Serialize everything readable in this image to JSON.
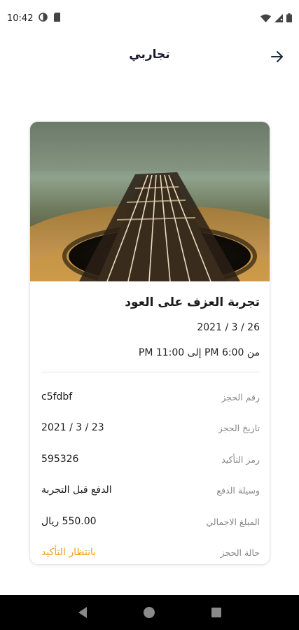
{
  "status_bar": {
    "time": "10:42"
  },
  "header": {
    "title": "تجاربي",
    "back_icon": "arrow-right-icon"
  },
  "booking": {
    "image_alt": "oud-instrument-photo",
    "title": "تجربة العزف على العود",
    "date": "26 / 3 / 2021",
    "time_range": "من 6:00 PM إلى 11:00 PM",
    "details": [
      {
        "label": "رقم الحجز",
        "value": "c5fdbf"
      },
      {
        "label": "تاريخ الحجز",
        "value": "23 / 3 / 2021"
      },
      {
        "label": "رمز التأكيد",
        "value": "595326"
      },
      {
        "label": "وسيلة الدفع",
        "value": "الدفع قبل التجربة"
      },
      {
        "label": "المبلغ الاجمالي",
        "value": "550.00 ريال"
      },
      {
        "label": "حالة الحجز",
        "value": "بانتظار التأكيد"
      }
    ],
    "status_color": "#f0a020"
  },
  "nav": {
    "back": "back-triangle-icon",
    "home": "home-circle-icon",
    "recents": "recents-square-icon"
  }
}
